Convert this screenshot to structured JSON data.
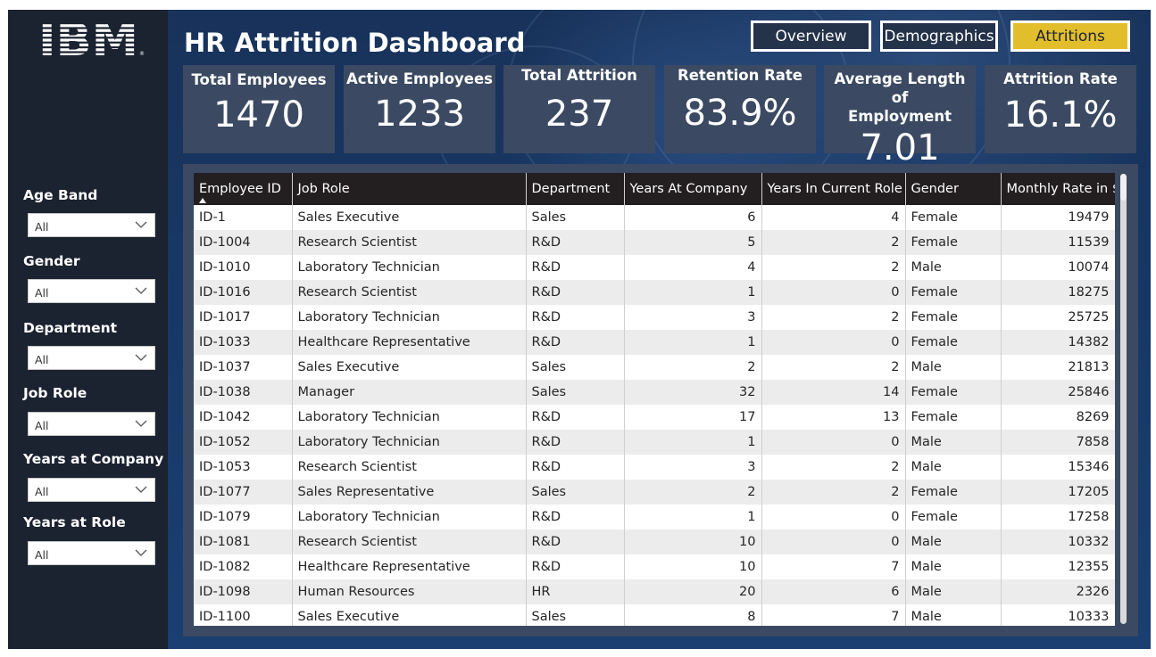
{
  "app": {
    "logo_text": "IBM",
    "title": "HR Attrition Dashboard"
  },
  "nav": {
    "overview": "Overview",
    "demographics": "Demographics",
    "attritions": "Attritions",
    "active": "Attritions"
  },
  "kpis": {
    "total_employees": {
      "label": "Total Employees",
      "value": "1470"
    },
    "active_employees": {
      "label": "Active Employees",
      "value": "1233"
    },
    "total_attrition": {
      "label": "Total Attrition",
      "value": "237"
    },
    "retention_rate": {
      "label": "Retention Rate",
      "value": "83.9%"
    },
    "avg_length": {
      "label_line1": "Average Length of",
      "label_line2": "Employment",
      "value": "7.01"
    },
    "attrition_rate": {
      "label": "Attrition Rate",
      "value": "16.1%"
    }
  },
  "filters": {
    "age_band": {
      "label": "Age Band",
      "value": "All"
    },
    "gender": {
      "label": "Gender",
      "value": "All"
    },
    "department": {
      "label": "Department",
      "value": "All"
    },
    "job_role": {
      "label": "Job Role",
      "value": "All"
    },
    "years_company": {
      "label": "Years at Company",
      "value": "All"
    },
    "years_role": {
      "label": "Years at Role",
      "value": "All"
    }
  },
  "table": {
    "columns": [
      "Employee ID",
      "Job Role",
      "Department",
      "Years At Company",
      "Years In Current Role",
      "Gender",
      "Monthly Rate in $"
    ],
    "sorted_column": "Employee ID",
    "rows": [
      [
        "ID-1",
        "Sales Executive",
        "Sales",
        "6",
        "4",
        "Female",
        "19479"
      ],
      [
        "ID-1004",
        "Research Scientist",
        "R&D",
        "5",
        "2",
        "Female",
        "11539"
      ],
      [
        "ID-1010",
        "Laboratory Technician",
        "R&D",
        "4",
        "2",
        "Male",
        "10074"
      ],
      [
        "ID-1016",
        "Research Scientist",
        "R&D",
        "1",
        "0",
        "Female",
        "18275"
      ],
      [
        "ID-1017",
        "Laboratory Technician",
        "R&D",
        "3",
        "2",
        "Female",
        "25725"
      ],
      [
        "ID-1033",
        "Healthcare Representative",
        "R&D",
        "1",
        "0",
        "Female",
        "14382"
      ],
      [
        "ID-1037",
        "Sales Executive",
        "Sales",
        "2",
        "2",
        "Male",
        "21813"
      ],
      [
        "ID-1038",
        "Manager",
        "Sales",
        "32",
        "14",
        "Female",
        "25846"
      ],
      [
        "ID-1042",
        "Laboratory Technician",
        "R&D",
        "17",
        "13",
        "Female",
        "8269"
      ],
      [
        "ID-1052",
        "Laboratory Technician",
        "R&D",
        "1",
        "0",
        "Male",
        "7858"
      ],
      [
        "ID-1053",
        "Research Scientist",
        "R&D",
        "3",
        "2",
        "Male",
        "15346"
      ],
      [
        "ID-1077",
        "Sales Representative",
        "Sales",
        "2",
        "2",
        "Female",
        "17205"
      ],
      [
        "ID-1079",
        "Laboratory Technician",
        "R&D",
        "1",
        "0",
        "Female",
        "17258"
      ],
      [
        "ID-1081",
        "Research Scientist",
        "R&D",
        "10",
        "0",
        "Male",
        "10332"
      ],
      [
        "ID-1082",
        "Healthcare Representative",
        "R&D",
        "10",
        "7",
        "Male",
        "12355"
      ],
      [
        "ID-1098",
        "Human Resources",
        "HR",
        "20",
        "6",
        "Male",
        "2326"
      ],
      [
        "ID-1100",
        "Sales Executive",
        "Sales",
        "8",
        "7",
        "Male",
        "10333"
      ]
    ]
  },
  "colors": {
    "sidebar_bg": "#1b2230",
    "card_bg": "#3b4a62",
    "accent": "#e2be2d",
    "header_bg": "#231f20"
  }
}
